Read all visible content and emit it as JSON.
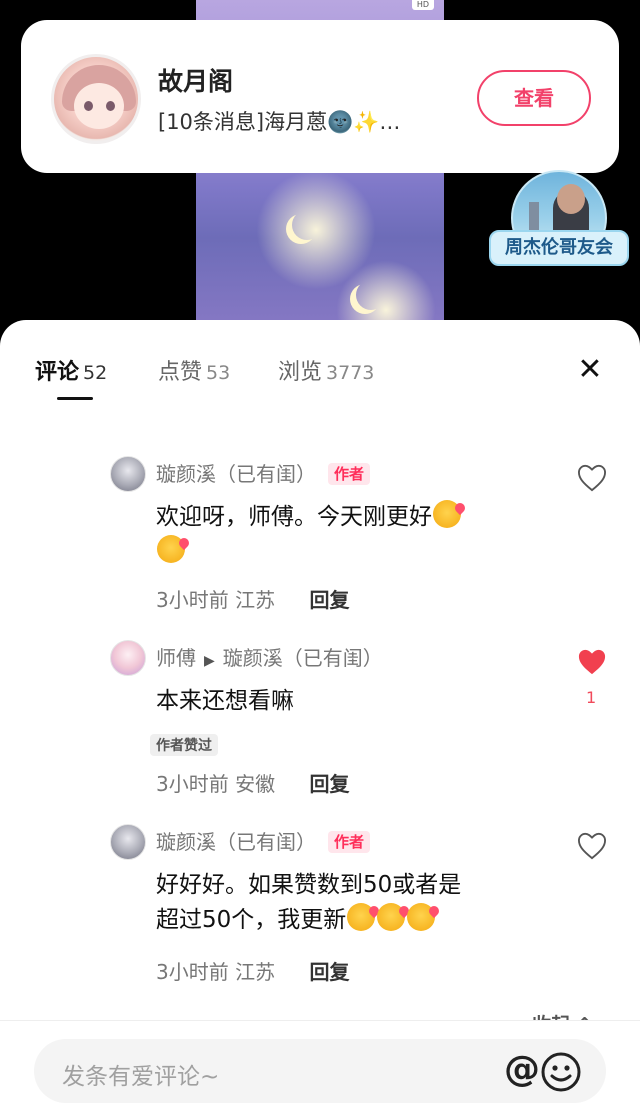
{
  "notification": {
    "title": "故月阁",
    "message": "[10条消息]海月蒽🌚✨…",
    "view_label": "查看"
  },
  "group": {
    "label": "周杰伦哥友会"
  },
  "tabs": [
    {
      "label": "评论",
      "count": "52"
    },
    {
      "label": "点赞",
      "count": "53"
    },
    {
      "label": "浏览",
      "count": "3773"
    }
  ],
  "comments": [
    {
      "author": "璇颜溪（已有闺）",
      "badge": "作者",
      "text": "欢迎呀，师傅。今天刚更好",
      "time": "3小时前",
      "location": "江苏",
      "reply_label": "回复"
    },
    {
      "author": "师傅",
      "reply_to": "璇颜溪（已有闺）",
      "text": "本来还想看嘛",
      "liked_by_author": "作者赞过",
      "time": "3小时前",
      "location": "安徽",
      "reply_label": "回复",
      "like_count": "1"
    },
    {
      "author": "璇颜溪（已有闺）",
      "badge": "作者",
      "text_line1": "好好好。如果赞数到50或者是",
      "text_line2": "超过50个，我更新",
      "time": "3小时前",
      "location": "江苏",
      "reply_label": "回复"
    }
  ],
  "collapse_label": "收起 ⌃",
  "input": {
    "placeholder": "发条有爱评论~"
  },
  "colors": {
    "accent": "#f2416a",
    "like_red": "#f14a5b"
  }
}
